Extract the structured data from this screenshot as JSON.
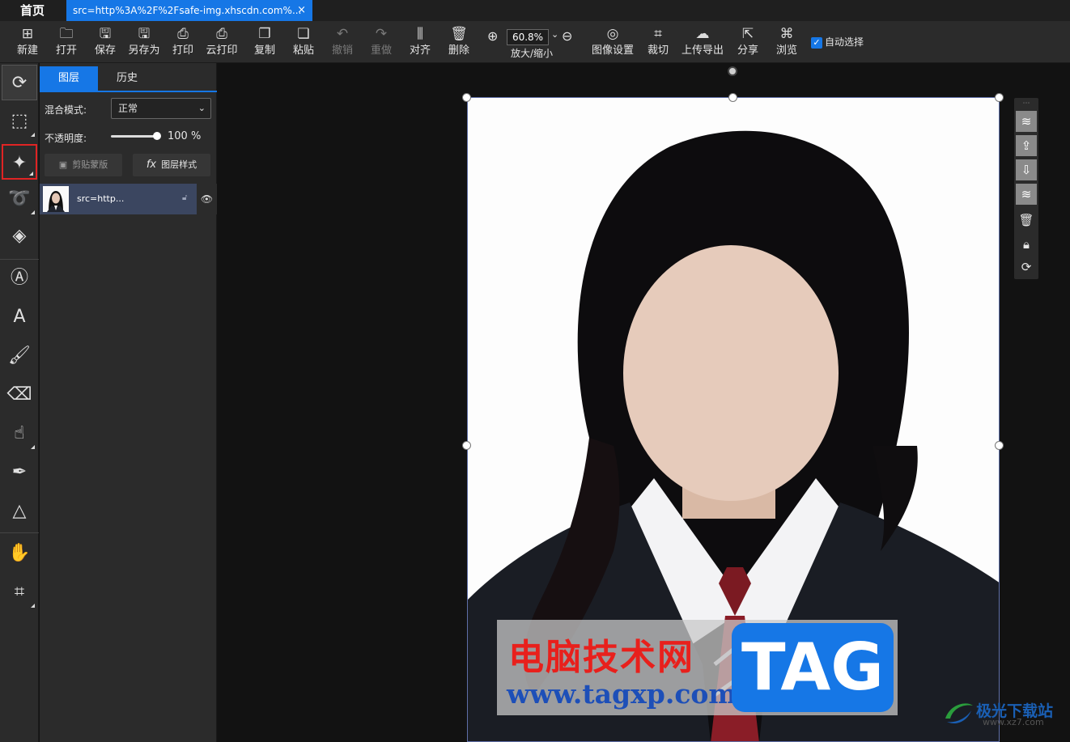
{
  "tabs": {
    "home": "首页",
    "document": "src=http%3A%2F%2Fsafe-img.xhscdn.com%...",
    "close": "×"
  },
  "toolbar": {
    "items": [
      {
        "label": "新建",
        "icon": "plus-square-icon",
        "glyph": "⊞"
      },
      {
        "label": "打开",
        "icon": "folder-icon",
        "glyph": "🗀"
      },
      {
        "label": "保存",
        "icon": "save-icon",
        "glyph": "🖫"
      },
      {
        "label": "另存为",
        "icon": "save-as-icon",
        "glyph": "🖫"
      },
      {
        "label": "打印",
        "icon": "printer-icon",
        "glyph": "⎙"
      },
      {
        "label": "云打印",
        "icon": "cloud-printer-icon",
        "glyph": "⎙"
      },
      {
        "label": "复制",
        "icon": "copy-icon",
        "glyph": "❐"
      },
      {
        "label": "粘贴",
        "icon": "paste-icon",
        "glyph": "❏"
      },
      {
        "label": "撤销",
        "icon": "undo-icon",
        "glyph": "↶"
      },
      {
        "label": "重做",
        "icon": "redo-icon",
        "glyph": "↷"
      },
      {
        "label": "对齐",
        "icon": "align-icon",
        "glyph": "⫼"
      },
      {
        "label": "删除",
        "icon": "trash-icon",
        "glyph": "🗑"
      }
    ],
    "zoom": {
      "value": "60.8%",
      "label": "放大/缩小",
      "zoom_in": "⊕",
      "zoom_out": "⊖",
      "chevron": "⌄"
    },
    "items_right": [
      {
        "label": "图像设置",
        "icon": "image-settings-icon",
        "glyph": "◎"
      },
      {
        "label": "裁切",
        "icon": "crop-icon",
        "glyph": "⌗"
      },
      {
        "label": "上传导出",
        "icon": "cloud-upload-icon",
        "glyph": "☁"
      },
      {
        "label": "分享",
        "icon": "share-icon",
        "glyph": "⇱"
      },
      {
        "label": "浏览",
        "icon": "browse-icon",
        "glyph": "⌘"
      }
    ],
    "auto_select": {
      "label": "自动选择",
      "checked": true
    }
  },
  "tools": [
    {
      "name": "select-tool",
      "glyph": "⟳"
    },
    {
      "name": "marquee-tool",
      "glyph": "⬚"
    },
    {
      "name": "magic-wand-tool",
      "glyph": "✦"
    },
    {
      "name": "lasso-tool",
      "glyph": "➰"
    },
    {
      "name": "paint-bucket-tool",
      "glyph": "◈"
    },
    {
      "name": "add-text-tool",
      "glyph": "Ⓐ"
    },
    {
      "name": "text-tool",
      "glyph": "A"
    },
    {
      "name": "brush-tool",
      "glyph": "🖌"
    },
    {
      "name": "eraser-tool",
      "glyph": "⌫"
    },
    {
      "name": "smudge-tool",
      "glyph": "☝"
    },
    {
      "name": "pen-tool",
      "glyph": "✒"
    },
    {
      "name": "shape-tool",
      "glyph": "△"
    },
    {
      "name": "hand-tool",
      "glyph": "✋"
    },
    {
      "name": "transform-tool",
      "glyph": "⌗"
    }
  ],
  "panel": {
    "tab_layers": "图层",
    "tab_history": "历史",
    "blend_label": "混合模式:",
    "blend_value": "正常",
    "opacity_label": "不透明度:",
    "opacity_value": "100 %",
    "opacity_level": 1.0,
    "clip_mask": "剪贴蒙版",
    "layer_style_fx": "fx",
    "layer_style": "图层样式",
    "layer_name": "src=http..."
  },
  "watermark": {
    "cn": "电脑技术网",
    "url": "www.tagxp.com",
    "tag": "TAG",
    "site2_cn": "极光下载站",
    "site2_url": "www.xz7.com"
  },
  "colors": {
    "accent": "#1677e6",
    "highlight": "#e02424",
    "panel": "#2b2b2b",
    "canvas": "#121212"
  }
}
